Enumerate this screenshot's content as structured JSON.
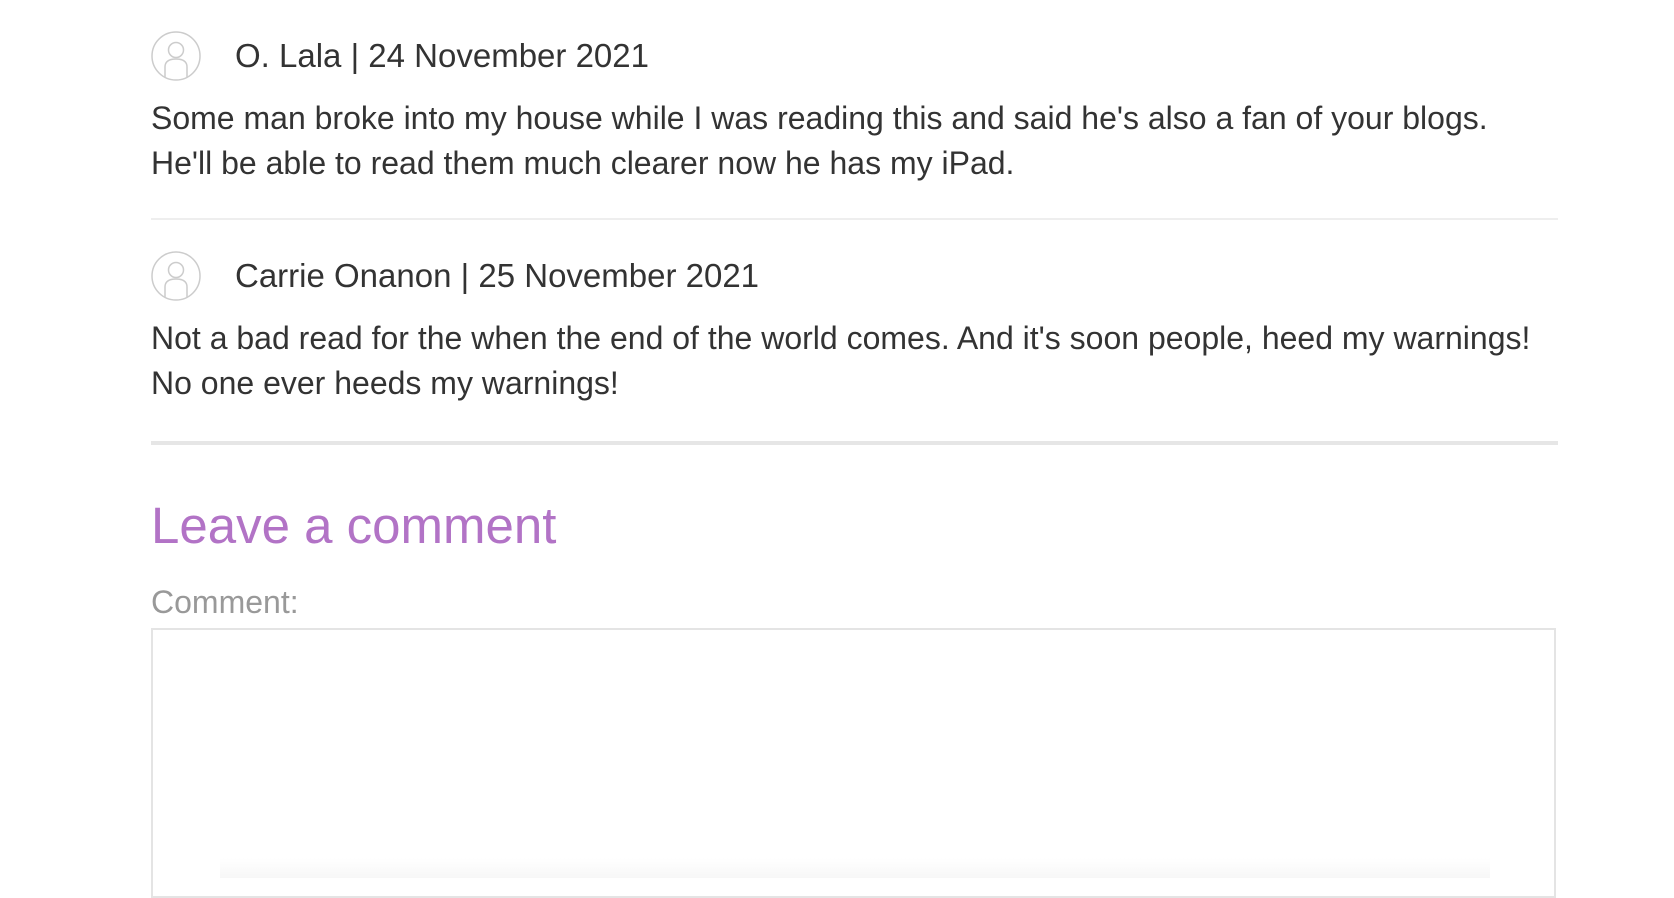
{
  "comments": [
    {
      "meta": "O. Lala | 24 November 2021",
      "text": "Some man broke into my house while I was reading this and said he's also a fan of your blogs. He'll be able to read them much clearer now he has my iPad.",
      "line1": "Some man broke into my house while I was reading this and said he's also a fan of your blogs.",
      "line2": "He'll be able to read them much clearer now he has my iPad."
    },
    {
      "meta": "Carrie Onanon | 25 November 2021",
      "line1": "Not a bad read for the when the end of the world comes. And it's soon people, heed my warnings!",
      "line2": "No one ever heeds my warnings!"
    }
  ],
  "leave_comment": {
    "heading": "Leave a comment",
    "label": "Comment:",
    "textarea_value": ""
  },
  "colors": {
    "heading_accent": "#b273c6",
    "label_gray": "#999999",
    "text": "#333333"
  },
  "icons": {
    "avatar": "user-avatar-icon"
  }
}
